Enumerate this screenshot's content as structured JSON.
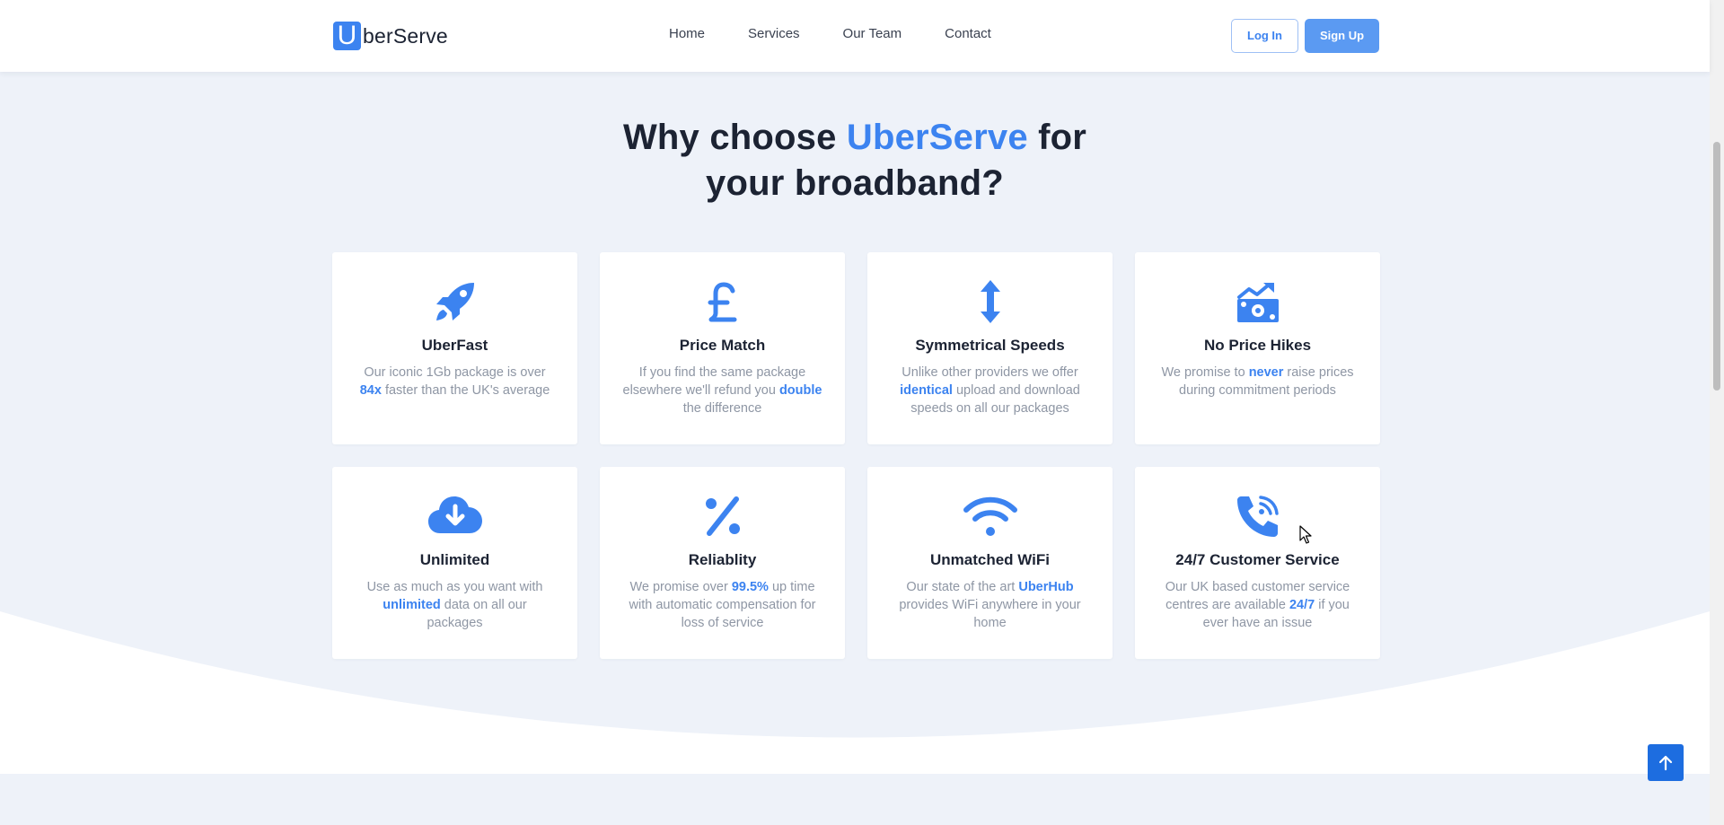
{
  "brand": {
    "logo_letter": "U",
    "logo_rest": "berServe"
  },
  "nav": {
    "links": [
      "Home",
      "Services",
      "Our Team",
      "Contact"
    ],
    "login_label": "Log In",
    "signup_label": "Sign Up"
  },
  "section": {
    "heading_part1": "Why choose ",
    "heading_accent": "UberServe",
    "heading_part2": " for",
    "heading_line2": "your broadband?"
  },
  "features": [
    {
      "icon": "rocket-icon",
      "title": "UberFast",
      "desc": [
        "Our iconic 1Gb package is over ",
        {
          "b": "84x"
        },
        " faster than the UK's average"
      ]
    },
    {
      "icon": "pound-icon",
      "title": "Price Match",
      "desc": [
        "If you find the same package elsewhere we'll refund you ",
        {
          "b": "double"
        },
        " the difference"
      ]
    },
    {
      "icon": "arrows-vertical-icon",
      "title": "Symmetrical Speeds",
      "desc": [
        "Unlike other providers we offer ",
        {
          "b": "identical"
        },
        " upload and download speeds on all our packages"
      ]
    },
    {
      "icon": "money-chart-icon",
      "title": "No Price Hikes",
      "desc": [
        "We promise to ",
        {
          "b": "never"
        },
        " raise prices during commitment periods"
      ]
    },
    {
      "icon": "cloud-download-icon",
      "title": "Unlimited",
      "desc": [
        "Use as much as you want with ",
        {
          "b": "unlimited"
        },
        " data on all our packages"
      ]
    },
    {
      "icon": "percent-icon",
      "title": "Reliablity",
      "desc": [
        "We promise over ",
        {
          "b": "99.5%"
        },
        " up time with automatic compensation for loss of service"
      ]
    },
    {
      "icon": "wifi-icon",
      "title": "Unmatched WiFi",
      "desc": [
        "Our state of the art ",
        {
          "b": "UberHub"
        },
        " provides WiFi anywhere in your home"
      ]
    },
    {
      "icon": "phone-volume-icon",
      "title": "24/7 Customer Service",
      "desc": [
        "Our UK based customer service centres are available ",
        {
          "b": "24/7"
        },
        " if you ever have an issue"
      ]
    }
  ],
  "colors": {
    "accent": "#3c83f0",
    "section_bg": "#eef2f9",
    "text_dark": "#1c2333",
    "text_muted": "#8e96a4"
  }
}
